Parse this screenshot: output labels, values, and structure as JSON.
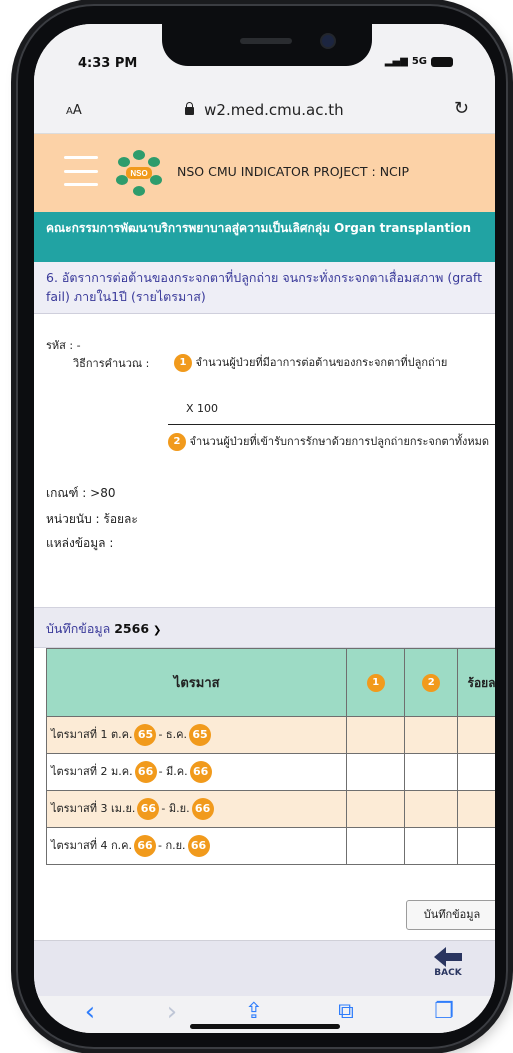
{
  "status": {
    "time": "4:33 PM",
    "network": "5G"
  },
  "browser": {
    "text_size": "AA",
    "url": "w2.med.cmu.ac.th",
    "reload_icon": "reload-icon"
  },
  "header": {
    "logo_text": "NSO",
    "title": "NSO CMU INDICATOR PROJECT : NCIP"
  },
  "section": {
    "title": "คณะกรรมการพัฒนาบริการพยาบาลสู่ความเป็นเลิศกลุ่ม Organ transplantion"
  },
  "indicator": {
    "title": "6. อัตราการต่อต้านของกระจกตาที่ปลูกถ่าย จนกระทั่งกระจกตาเสื่อมสภาพ (graft fail) ภายใน1ปี (รายไตรมาส)"
  },
  "details": {
    "code": "รหัส : -",
    "calc_label": "วิธีการคำนวณ :",
    "badge1": "1",
    "numerator": "จำนวนผู้ป่วยที่มีอาการต่อต้านของกระจกตาที่ปลูกถ่าย",
    "multiplier": "X 100",
    "badge2": "2",
    "denominator": "จำนวนผู้ป่วยที่เข้ารับการรักษาด้วยการปลูกถ่ายกระจกตาทั้งหมด",
    "criterion": "เกณฑ์ : >80",
    "unit": "หน่วยนับ : ร้อยละ",
    "source": "แหล่งข้อมูล :"
  },
  "record": {
    "label": "บันทึกข้อมูล",
    "year": "2566"
  },
  "table": {
    "headers": {
      "quarter": "ไตรมาส",
      "col1": "1",
      "col2": "2",
      "percent": "ร้อยละ"
    },
    "rows": [
      {
        "q": "ไตรมาสที่ 1 ต.ค.",
        "y1": "65",
        "sep": "- ธ.ค.",
        "y2": "65"
      },
      {
        "q": "ไตรมาสที่ 2 ม.ค.",
        "y1": "66",
        "sep": "- มี.ค.",
        "y2": "66"
      },
      {
        "q": "ไตรมาสที่ 3 เม.ย.",
        "y1": "66",
        "sep": "- มิ.ย.",
        "y2": "66"
      },
      {
        "q": "ไตรมาสที่ 4 ก.ค.",
        "y1": "66",
        "sep": "- ก.ย.",
        "y2": "66"
      }
    ]
  },
  "save_button": "บันทึกข้อมูล",
  "back_button": "BACK",
  "toolbar": {
    "back": "‹",
    "forward": "›",
    "share": "⇪",
    "bookmarks": "⧉",
    "tabs": "❐"
  }
}
